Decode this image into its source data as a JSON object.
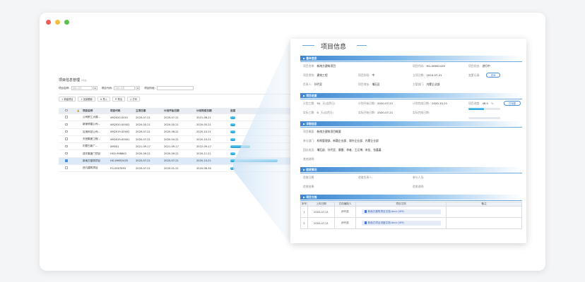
{
  "list_page": {
    "title": "项目信息管理",
    "title_sub": "(列表)",
    "filters": [
      {
        "label": "项目名称:",
        "placeholder": "请输入项目",
        "btn": "⊕"
      },
      {
        "label": "项目代码:",
        "placeholder": "请输入项目",
        "btn": "⊕"
      },
      {
        "label": "项目阶段:"
      }
    ],
    "buttons": [
      "+ 新建项目",
      "+ 批量删除",
      "⇅ 导入",
      "⇱ 导出",
      "⎙ 打印"
    ],
    "columns": [
      "",
      "",
      "项目名称",
      "项目代码",
      "立项日期",
      "计划开始日期",
      "计划完成日期",
      "进度"
    ],
    "rows": [
      {
        "name": "公司职工大楼...",
        "code": "XM2020-0001",
        "setup": "2020-07-21",
        "start": "2020-07-21",
        "end": "2021-06-21",
        "progress": 0.05,
        "selected": false
      },
      {
        "name": "新家修建公司...",
        "code": "XM2020-00002",
        "setup": "2020-05-21",
        "start": "2020-05-21",
        "end": "2020-05-21",
        "progress": 0.05,
        "selected": false
      },
      {
        "name": "应用科技公司...",
        "code": "XM2019-00002",
        "setup": "2020-07-21",
        "start": "2020-06-21",
        "end": "2020-10-21",
        "progress": 0.05,
        "selected": false
      },
      {
        "name": "天宫集团工程...",
        "code": "XM2019-00001",
        "setup": "2020-07-21",
        "start": "2020-04-21",
        "end": "2020-10-21",
        "progress": 0.05,
        "selected": false
      },
      {
        "name": "内蒙古新厂...",
        "code": "XM001",
        "setup": "2021-09-17",
        "start": "2021-09-17",
        "end": "2022-09-17",
        "progress": 0.2,
        "selected": false
      },
      {
        "name": "成东集团门项目",
        "code": "HG0-998843",
        "setup": "2020-09-21",
        "start": "2020-09-21",
        "end": "2020-11-21",
        "progress": 0.05,
        "selected": false
      },
      {
        "name": "新南方建筑项目",
        "code": "HG-09652435",
        "setup": "2020-07-21",
        "start": "2020-07-21",
        "end": "2020-10-21",
        "progress": 0.48,
        "selected": true
      },
      {
        "name": "西凡建筑项目",
        "code": "FG-0007893",
        "setup": "2020-07-21",
        "start": "2020-01-21",
        "end": "2020-06-30",
        "progress": 0.05,
        "selected": false
      }
    ]
  },
  "detail": {
    "title": "项目信息",
    "sections": {
      "basic": "基本信息",
      "progress": "项目进度",
      "detail": "详细信息",
      "acceptance": "验收情况",
      "docs": "项目文档"
    },
    "basic": {
      "name_k": "项目名称:",
      "name_v": "新南方建筑项目",
      "code_k": "项目代码:",
      "code_v": "HG-09652435",
      "status_k": "项目状态:",
      "status_v": "进行中",
      "type_k": "项目类别:",
      "type_v": "建筑工程",
      "stage_k": "项目阶段:",
      "stage_v": "中",
      "setup_k": "立项日期:",
      "setup_v": "2020-07-21",
      "change_k": "变更记录:",
      "change_btn": "查询",
      "owner_k": "负责人:",
      "owner_v": "孙代亚",
      "site_k": "项目地址:",
      "site_v": "埔石区",
      "dept_k": "主管部门:",
      "dept_v": "内蒙企业部"
    },
    "progress": {
      "plan_k": "计划工期:",
      "plan_v": "91",
      "plan_u": "天(自然日)",
      "pstart_k": "计划开始日期:",
      "pstart_v": "2020-07-21",
      "pend_k": "计划完成日期:",
      "pend_v": "2020-10-21",
      "pct_k": "项目进度:",
      "pct_v": "48.0",
      "pct_u": "%",
      "pct_btn": "甘特图",
      "actual_k": "实际工期:",
      "actual_v": "0",
      "actual_u": "天(自然日)",
      "astart_k": "实际开始日期:",
      "astart_v": "2020-07-21",
      "aend_k": "实际完成日期:",
      "pct_value": 0.48,
      "actual_pct_value": 0.0
    },
    "detail": {
      "summary_k": "项目概要:",
      "summary_v": "新南方建筑项目概要",
      "dept_k": "参与部门:",
      "dept_v": "机构管理部、新疆企业部、湖外企业部、内蒙企业部",
      "team_k": "团队成员:",
      "team_v": "埔石部、孙代亚、康雷、李者、王元博、宋佳、张嘉嘉",
      "remark_k": "其他说明:"
    },
    "acceptance": {
      "date_k": "验收日期:",
      "by_k": "验收负责人:",
      "with_k": "参与人员:",
      "result_k": "验收结果:",
      "desc_k": "验收说明:"
    },
    "docs": {
      "headers": [
        "序号",
        "上传日期",
        "文档编制人",
        "项目文档",
        "备注"
      ],
      "rows": [
        {
          "no": "1",
          "date": "2020-07-21",
          "author": "孙代亚",
          "file": "新南方建筑项目文档.docx (5M)",
          "note": ""
        },
        {
          "no": "2",
          "date": "2020-07-21",
          "author": "孙代亚",
          "file": "新南方项目进度文档.docx (5M)",
          "note": ""
        }
      ]
    }
  }
}
